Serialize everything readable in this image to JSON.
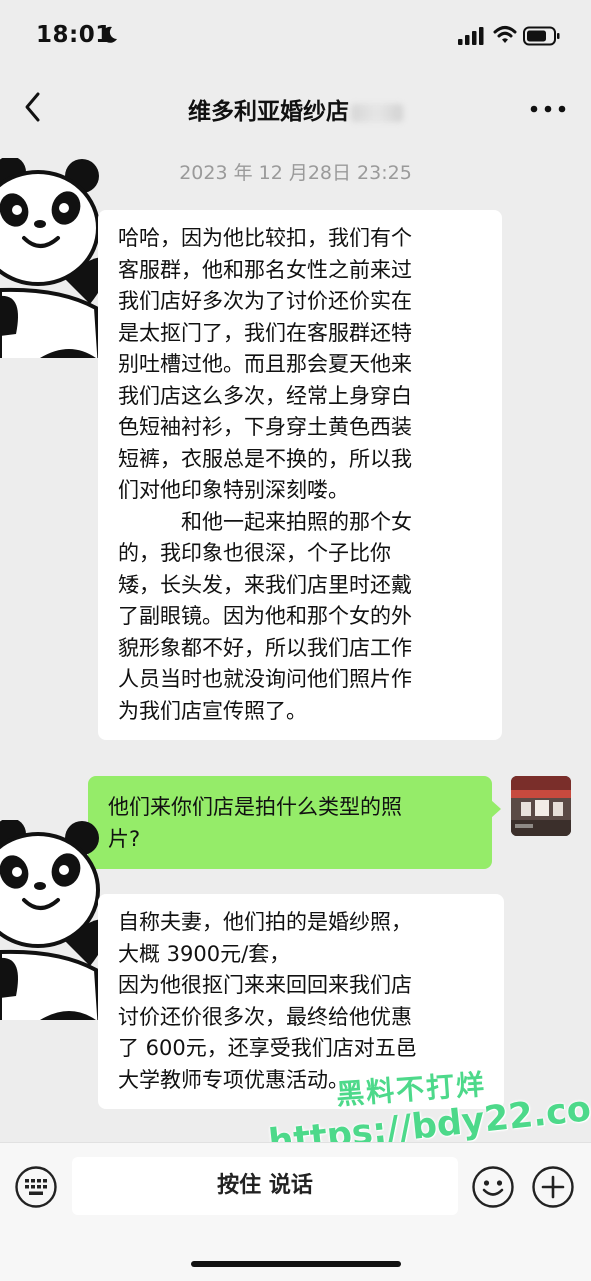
{
  "status_bar": {
    "time": "18:01"
  },
  "header": {
    "title": "维多利亚婚纱店"
  },
  "chat": {
    "timestamp": "2023 年 12 月28日 23:25",
    "message1_lines": [
      "哈哈，因为他比较扣，我们有个",
      "客服群，他和那名女性之前来过",
      "我们店好多次为了讨价还价实在",
      "是太抠门了，我们在客服群还特",
      "别吐槽过他。而且那会夏天他来",
      "我们店这么多次，经常上身穿白",
      "色短袖衬衫，下身穿土黄色西装",
      "短裤，衣服总是不换的，所以我",
      "们对他印象特别深刻喽。",
      "和他一起来拍照的那个女",
      "的，我印象也很深，个子比你",
      "矮，长头发，来我们店里时还戴",
      "了副眼镜。因为他和那个女的外",
      "貌形象都不好，所以我们店工作",
      "人员当时也就没询问他们照片作",
      "为我们店宣传照了。"
    ],
    "message2_lines": [
      "他们来你们店是拍什么类型的照",
      "片?"
    ],
    "message3_lines": [
      "自称夫妻，他们拍的是婚纱照，",
      "大概 3900元/套，",
      "因为他很抠门来来回回来我们店",
      "讨价还价很多次，最终给他优惠",
      "了 600元，还享受我们店对五邑",
      "大学教师专项优惠活动。"
    ]
  },
  "watermark": {
    "line1": "黑料不打烊",
    "line2": "https://bdy22.co"
  },
  "input_bar": {
    "talk_label": "按住 说话"
  }
}
